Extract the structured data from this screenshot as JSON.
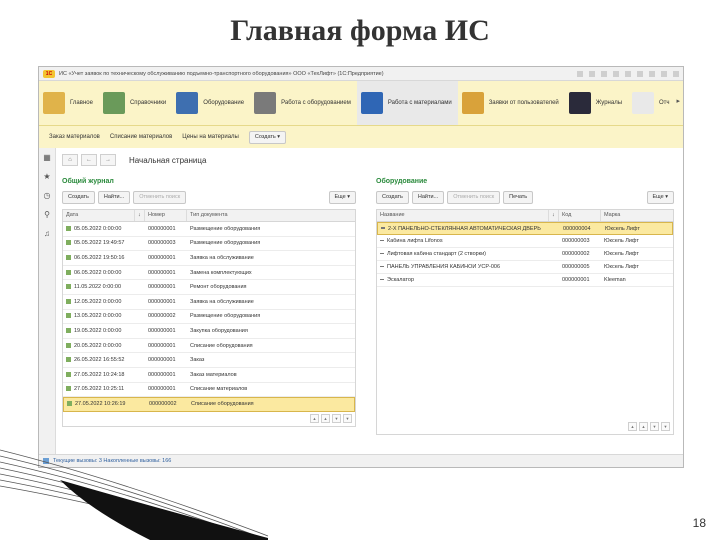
{
  "slide": {
    "title": "Главная форма ИС",
    "page_number": "18"
  },
  "window": {
    "logo": "1С",
    "title": "ИС «Учет заявок по техническому обслуживанию подъемно-транспортного оборудования» ООО «ТехЛифт» (1С:Предприятие)"
  },
  "sections": [
    {
      "label": "Главное",
      "icon": "home-icon",
      "color": "#e0b34a"
    },
    {
      "label": "Справочники",
      "icon": "books-icon",
      "color": "#6a9a5a"
    },
    {
      "label": "Оборудование",
      "icon": "equipment-icon",
      "color": "#3e6fb0"
    },
    {
      "label": "Работа с оборудованием",
      "icon": "tools-icon",
      "color": "#7a7a7a"
    },
    {
      "label": "Работа с материалами",
      "icon": "materials-icon",
      "color": "#2f66b5"
    },
    {
      "label": "Заявки от пользователей",
      "icon": "requests-icon",
      "color": "#d9a23a"
    },
    {
      "label": "Журналы",
      "icon": "journal-icon",
      "color": "#2a2a3a"
    },
    {
      "label": "Отч",
      "icon": "report-icon",
      "color": "#e9e9e9"
    }
  ],
  "active_section": 4,
  "commands": {
    "items": [
      "Заказ материалов",
      "Списание материалов",
      "Цены на материалы"
    ],
    "create": "Создать ▾"
  },
  "left_icons": [
    "grid-icon",
    "star-icon",
    "history-icon",
    "search-icon",
    "bell-icon"
  ],
  "left_glyphs": [
    "▦",
    "★",
    "◷",
    "⚲",
    "♫"
  ],
  "nav": {
    "home": "⌂",
    "back": "←",
    "forward": "→",
    "page_title": "Начальная страница"
  },
  "journal": {
    "title": "Общий журнал",
    "buttons": {
      "create": "Создать",
      "find": "Найти...",
      "cancel": "Отменить поиск",
      "more": "Еще ▾"
    },
    "columns": [
      "Дата",
      "↓",
      "Номер",
      "Тип документа"
    ],
    "rows": [
      {
        "date": "05.05.2022 0:00:00",
        "num": "000000001",
        "type": "Размещение оборудования"
      },
      {
        "date": "05.05.2022 19:49:57",
        "num": "000000003",
        "type": "Размещение оборудования"
      },
      {
        "date": "06.05.2022 19:50:16",
        "num": "000000001",
        "type": "Заявка на обслуживание"
      },
      {
        "date": "06.05.2022 0:00:00",
        "num": "000000001",
        "type": "Замена комплектующих"
      },
      {
        "date": "11.05.2022 0:00:00",
        "num": "000000001",
        "type": "Ремонт оборудования"
      },
      {
        "date": "12.05.2022 0:00:00",
        "num": "000000001",
        "type": "Заявка на обслуживание"
      },
      {
        "date": "13.05.2022 0:00:00",
        "num": "000000002",
        "type": "Размещение оборудования"
      },
      {
        "date": "19.05.2022 0:00:00",
        "num": "000000001",
        "type": "Закупка оборудования"
      },
      {
        "date": "20.05.2022 0:00:00",
        "num": "000000001",
        "type": "Списание оборудования"
      },
      {
        "date": "26.05.2022 16:55:52",
        "num": "000000001",
        "type": "Заказ"
      },
      {
        "date": "27.05.2022 10:24:18",
        "num": "000000001",
        "type": "Заказ материалов"
      },
      {
        "date": "27.05.2022 10:25:11",
        "num": "000000001",
        "type": "Списание материалов"
      },
      {
        "date": "27.05.2022 10:26:19",
        "num": "000000002",
        "type": "Списание оборудования"
      }
    ],
    "selected_row": 12
  },
  "equipment": {
    "title": "Оборудование",
    "buttons": {
      "create": "Создать",
      "find": "Найти...",
      "cancel": "Отменить поиск",
      "print": "Печать",
      "more": "Еще ▾"
    },
    "columns": [
      "Название",
      "↓",
      "Код",
      "Марка"
    ],
    "rows": [
      {
        "name": "2-Х ПАНЕЛЬНО-СТЕКЛЯННАЯ АВТОМАТИЧЕСКАЯ ДВЕРЬ",
        "code": "000000004",
        "brand": "Юксель Лифт"
      },
      {
        "name": "Кабина лифта Lifonos",
        "code": "000000003",
        "brand": "Юксель Лифт"
      },
      {
        "name": "Лифтовая кабина стандарт (2 створки)",
        "code": "000000002",
        "brand": "Юксель Лифт"
      },
      {
        "name": "ПАНЕЛЬ УПРАВЛЕНИЯ КАБИНОЙ УСР-006",
        "code": "000000005",
        "brand": "Юксель Лифт"
      },
      {
        "name": "Эскалатор",
        "code": "000000001",
        "brand": "Kleeman"
      }
    ],
    "selected_row": 0
  },
  "scroll_buttons": [
    "▲",
    "▲",
    "▼",
    "▼"
  ],
  "status": {
    "text": "Текущие вызовы: 3   Накопленные вызовы: 166"
  }
}
